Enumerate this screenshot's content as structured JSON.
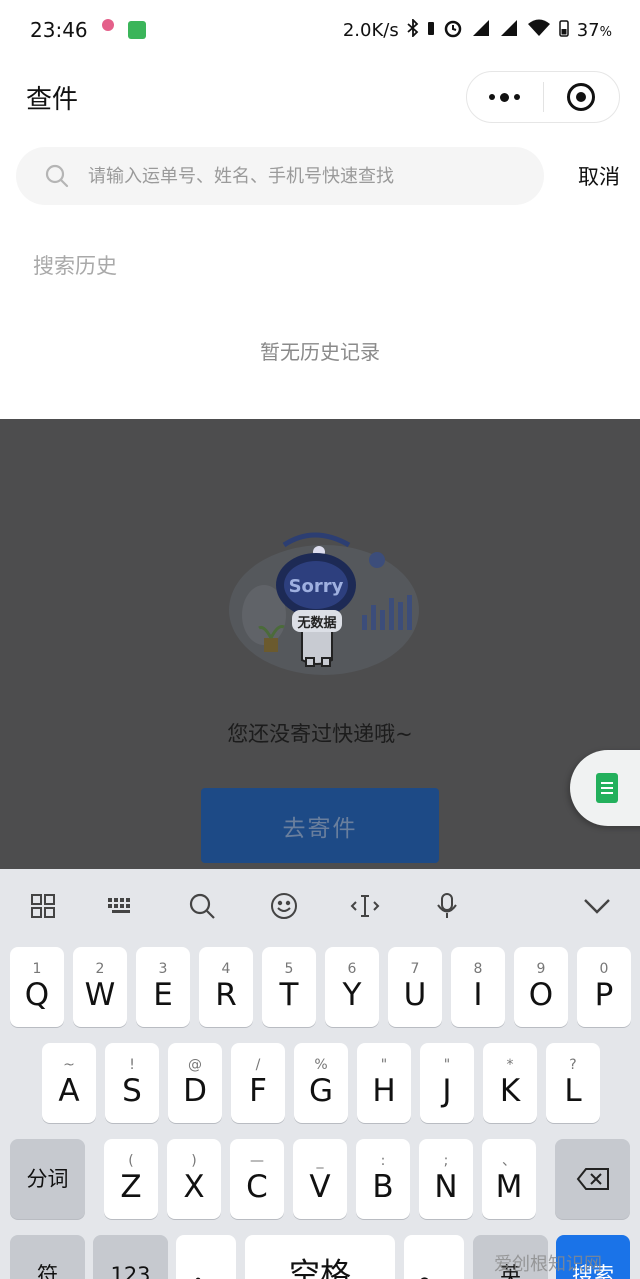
{
  "status_bar": {
    "time": "23:46",
    "network_speed": "2.0K/s",
    "battery": "37",
    "battery_unit": "%",
    "icons": [
      "notification-dot-icon",
      "app-notification-icon",
      "bluetooth-icon",
      "battery-small-icon",
      "alarm-icon",
      "hd-signal-icon",
      "hd-signal-icon",
      "wifi-icon",
      "battery-icon"
    ]
  },
  "nav": {
    "title": "查件",
    "more_icon": "more-dots-icon",
    "close_icon": "target-circle-icon"
  },
  "search": {
    "placeholder": "请输入运单号、姓名、手机号快速查找",
    "value": "",
    "cancel_label": "取消"
  },
  "history": {
    "title": "搜索历史",
    "empty_text": "暂无历史记录"
  },
  "empty_state": {
    "illustration_text_sorry": "Sorry",
    "illustration_text_nodata": "无数据",
    "message": "您还没寄过快递哦~",
    "button_label": "去寄件"
  },
  "keyboard": {
    "toolbar_icons": [
      "grid-icon",
      "keyboard-icon",
      "search-icon",
      "emoji-icon",
      "cursor-icon",
      "microphone-icon",
      "chevron-down-icon"
    ],
    "row1": [
      {
        "sub": "1",
        "main": "Q"
      },
      {
        "sub": "2",
        "main": "W"
      },
      {
        "sub": "3",
        "main": "E"
      },
      {
        "sub": "4",
        "main": "R"
      },
      {
        "sub": "5",
        "main": "T"
      },
      {
        "sub": "6",
        "main": "Y"
      },
      {
        "sub": "7",
        "main": "U"
      },
      {
        "sub": "8",
        "main": "I"
      },
      {
        "sub": "9",
        "main": "O"
      },
      {
        "sub": "0",
        "main": "P"
      }
    ],
    "row2": [
      {
        "sub": "~",
        "main": "A"
      },
      {
        "sub": "!",
        "main": "S"
      },
      {
        "sub": "@",
        "main": "D"
      },
      {
        "sub": "/",
        "main": "F"
      },
      {
        "sub": "%",
        "main": "G"
      },
      {
        "sub": "\"",
        "main": "H"
      },
      {
        "sub": "\"",
        "main": "J"
      },
      {
        "sub": "*",
        "main": "K"
      },
      {
        "sub": "?",
        "main": "L"
      }
    ],
    "row3_left": "分词",
    "row3": [
      {
        "sub": "(",
        "main": "Z"
      },
      {
        "sub": ")",
        "main": "X"
      },
      {
        "sub": "—",
        "main": "C"
      },
      {
        "sub": "_",
        "main": "V"
      },
      {
        "sub": ":",
        "main": "B"
      },
      {
        "sub": ";",
        "main": "N"
      },
      {
        "sub": "、",
        "main": "M"
      }
    ],
    "row4": {
      "symbol_label": "符",
      "number_label": "123",
      "comma_label": "，",
      "space_label": "空格",
      "period_label": "。",
      "lang_label": "英",
      "enter_label": "搜索"
    }
  },
  "watermark": "爱创根知识网"
}
